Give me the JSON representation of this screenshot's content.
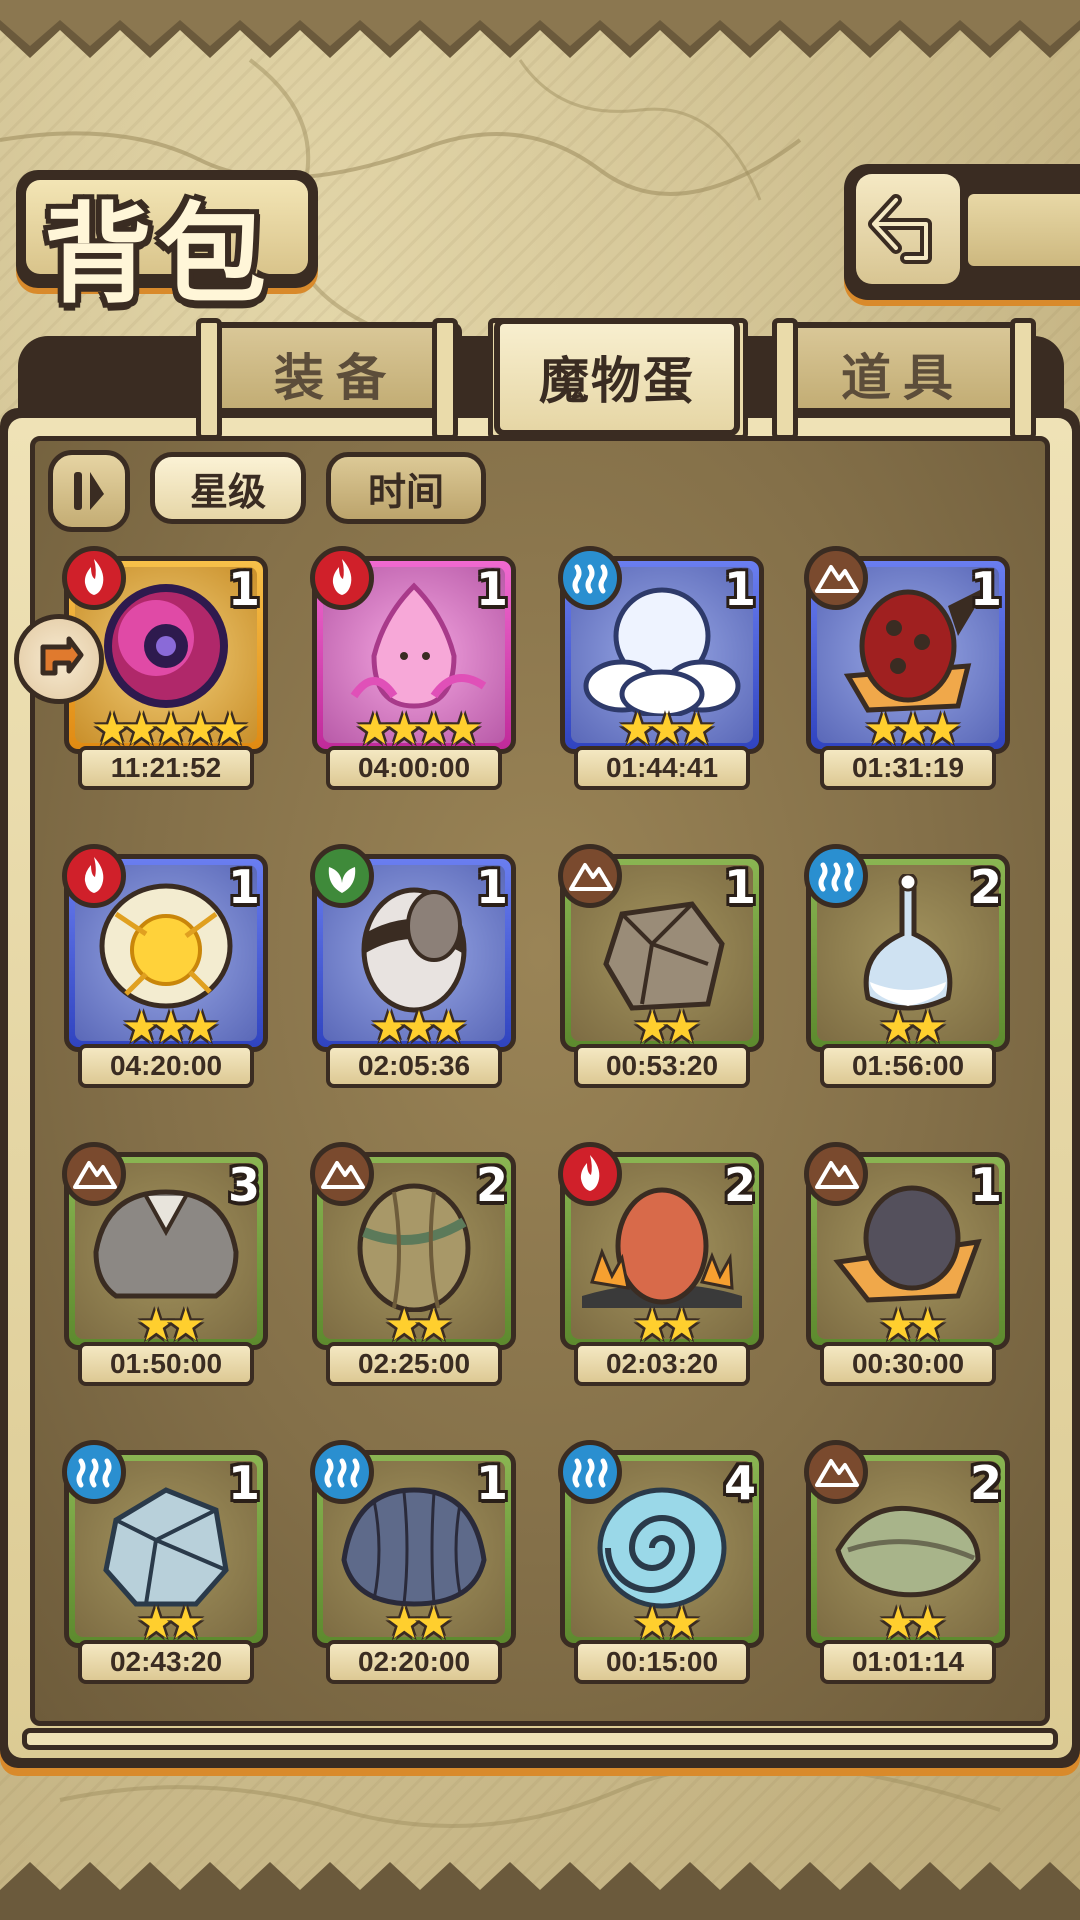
{
  "title": "背包",
  "tabs": [
    {
      "label": "装备",
      "active": false
    },
    {
      "label": "魔物蛋",
      "active": true
    },
    {
      "label": "道具",
      "active": false
    }
  ],
  "sort": {
    "star_label": "星级",
    "time_label": "时间",
    "selected": "星级"
  },
  "colors": {
    "fire": "#d0202a",
    "water": "#2a8fd0",
    "earth": "#7a4a2e",
    "grass": "#3f8a3a",
    "gold_frame": "#f0a21e",
    "pink_frame": "#e040b8",
    "blue_frame": "#4358d8",
    "green_frame": "#6e9a3c"
  },
  "eggs": [
    {
      "element": "fire",
      "count": "1",
      "stars": 5,
      "timer": "11:21:52",
      "frame": "gold_frame",
      "art": "purple-orb-egg"
    },
    {
      "element": "fire",
      "count": "1",
      "stars": 4,
      "timer": "04:00:00",
      "frame": "pink_frame",
      "art": "pink-slime-egg"
    },
    {
      "element": "water",
      "count": "1",
      "stars": 3,
      "timer": "01:44:41",
      "frame": "blue_frame",
      "art": "cloud-egg"
    },
    {
      "element": "earth",
      "count": "1",
      "stars": 3,
      "timer": "01:31:19",
      "frame": "blue_frame",
      "art": "red-spotted-egg"
    },
    {
      "element": "fire",
      "count": "1",
      "stars": 3,
      "timer": "04:20:00",
      "frame": "blue_frame",
      "art": "sun-egg"
    },
    {
      "element": "grass",
      "count": "1",
      "stars": 3,
      "timer": "02:05:36",
      "frame": "blue_frame",
      "art": "spiked-egg"
    },
    {
      "element": "earth",
      "count": "1",
      "stars": 2,
      "timer": "00:53:20",
      "frame": "green_frame",
      "art": "rock-egg"
    },
    {
      "element": "water",
      "count": "2",
      "stars": 2,
      "timer": "01:56:00",
      "frame": "green_frame",
      "art": "flask-egg"
    },
    {
      "element": "earth",
      "count": "3",
      "stars": 2,
      "timer": "01:50:00",
      "frame": "green_frame",
      "art": "furry-egg"
    },
    {
      "element": "earth",
      "count": "2",
      "stars": 2,
      "timer": "02:25:00",
      "frame": "green_frame",
      "art": "vine-egg"
    },
    {
      "element": "fire",
      "count": "2",
      "stars": 2,
      "timer": "02:03:20",
      "frame": "green_frame",
      "art": "lava-egg"
    },
    {
      "element": "earth",
      "count": "1",
      "stars": 2,
      "timer": "00:30:00",
      "frame": "green_frame",
      "art": "hat-egg"
    },
    {
      "element": "water",
      "count": "1",
      "stars": 2,
      "timer": "02:43:20",
      "frame": "green_frame",
      "art": "ice-rock-egg"
    },
    {
      "element": "water",
      "count": "1",
      "stars": 2,
      "timer": "02:20:00",
      "frame": "green_frame",
      "art": "shell-egg"
    },
    {
      "element": "water",
      "count": "4",
      "stars": 2,
      "timer": "00:15:00",
      "frame": "green_frame",
      "art": "spiral-shell-egg"
    },
    {
      "element": "earth",
      "count": "2",
      "stars": 2,
      "timer": "01:01:14",
      "frame": "green_frame",
      "art": "leaf-egg"
    }
  ]
}
